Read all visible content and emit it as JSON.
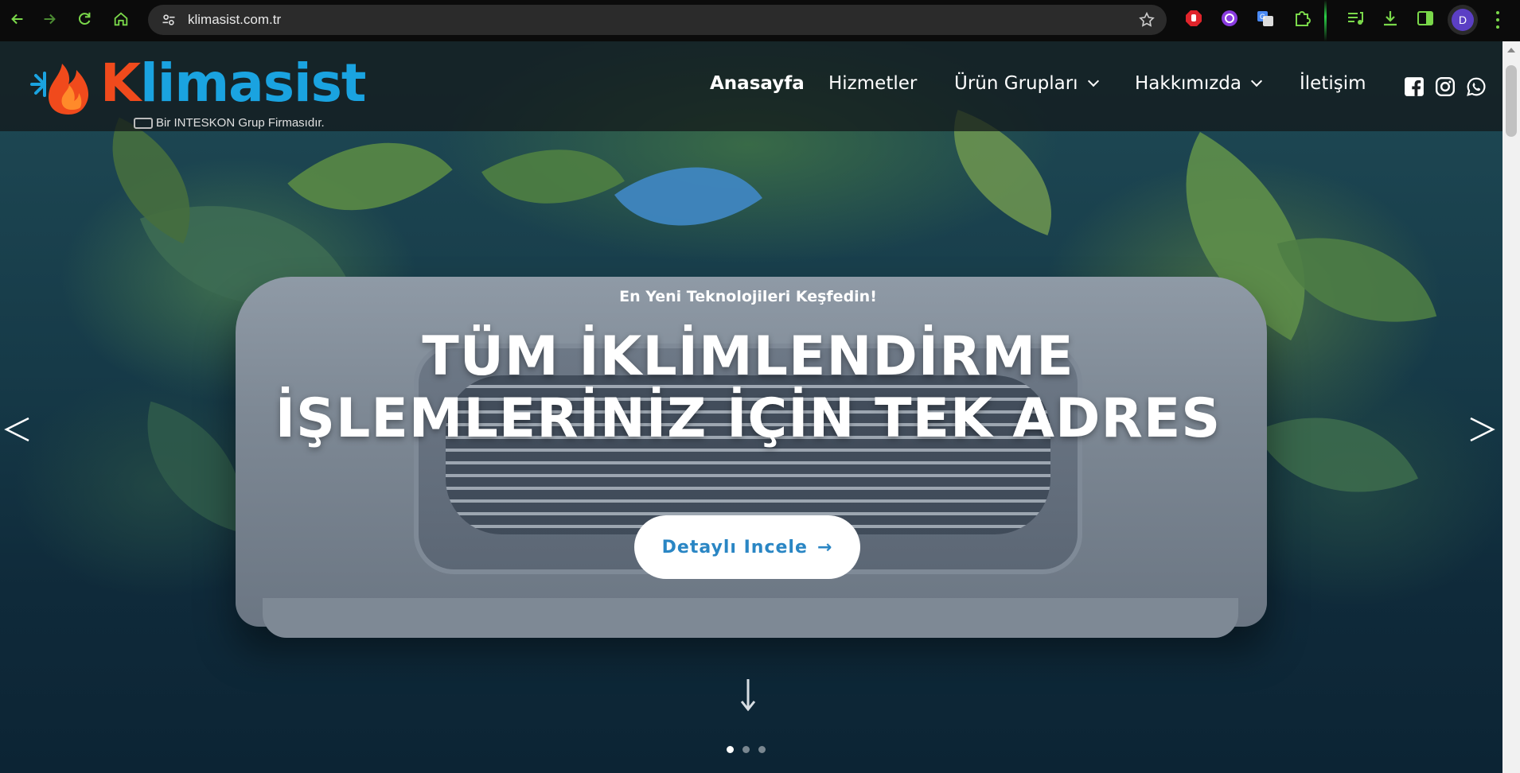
{
  "browser": {
    "url": "klimasist.com.tr",
    "profile_initial": "D",
    "icons": [
      "back-icon",
      "forward-icon",
      "reload-icon",
      "home-icon",
      "site-settings-icon",
      "bookmark-star-icon",
      "extension-icons",
      "profile-avatar",
      "menu-icon"
    ]
  },
  "site": {
    "logo_k": "K",
    "logo_rest": "limasist",
    "logo_tagline": "Bir INTESKON Grup Firmasıdır.",
    "nav": {
      "home": "Anasayfa",
      "services": "Hizmetler",
      "products": "Ürün Grupları",
      "about": "Hakkımızda",
      "contact": "İletişim"
    },
    "social_icons": [
      "facebook-icon",
      "instagram-icon",
      "whatsapp-icon"
    ]
  },
  "hero": {
    "eyebrow": "En Yeni Teknolojileri Keşfedin!",
    "headline_line1": "TÜM İKLİMLENDİRME",
    "headline_line2": "İŞLEMLERİNİZ İÇİN TEK ADRES",
    "cta_label": "Detaylı Incele",
    "cta_arrow": "→",
    "prev_label": "<",
    "next_label": ">",
    "slide_count": 3,
    "active_slide": 1
  },
  "colors": {
    "brand_orange": "#f04a1c",
    "brand_blue": "#1aa3e0",
    "cta_text": "#2a86c4",
    "chrome_accent": "#7ad84a"
  }
}
